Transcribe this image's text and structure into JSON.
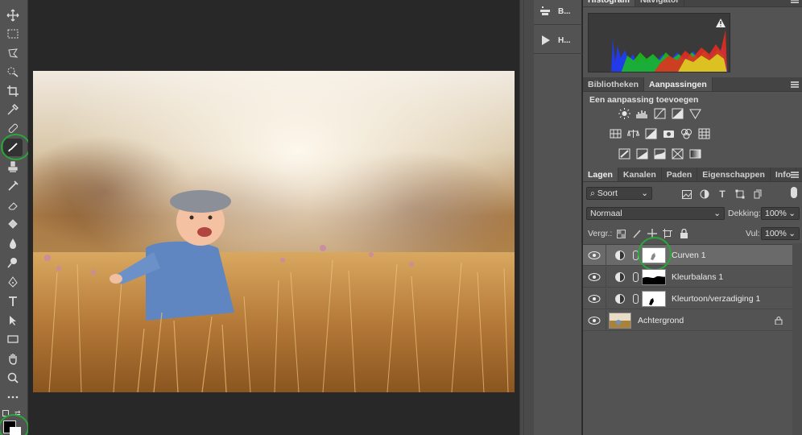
{
  "toolbar": {
    "tools": [
      "move-icon",
      "marquee-icon",
      "lasso-icon",
      "quick-select-icon",
      "crop-icon",
      "eyedropper-icon",
      "healing-icon",
      "brush-icon",
      "stamp-icon",
      "history-brush-icon",
      "eraser-icon",
      "paint-bucket-icon",
      "blur-icon",
      "dodge-icon",
      "pen-icon",
      "type-icon",
      "path-select-icon",
      "rectangle-icon",
      "hand-icon",
      "zoom-icon",
      "more-icon"
    ],
    "active_tool": "brush-icon",
    "highlight_color": "#2aa53a"
  },
  "mini_dock": {
    "items": [
      {
        "icon": "brushes-icon",
        "label": "B..."
      },
      {
        "icon": "play-icon",
        "label": "H..."
      }
    ]
  },
  "panels": {
    "top_tabs": [
      "Histogram",
      "Navigator"
    ],
    "adjust_tabs": [
      "Bibliotheken",
      "Aanpassingen"
    ],
    "adjust_title": "Een aanpassing toevoegen",
    "layer_tabs": [
      "Lagen",
      "Kanalen",
      "Paden",
      "Eigenschappen",
      "Info"
    ],
    "kind_filter": "Soort",
    "blend_mode": "Normaal",
    "opacity_label": "Dekking:",
    "opacity_value": "100%",
    "lock_label": "Vergr.:",
    "fill_label": "Vul:",
    "fill_value": "100%",
    "layers": [
      {
        "name": "Curven 1",
        "selected": true
      },
      {
        "name": "Kleurbalans 1",
        "selected": false
      },
      {
        "name": "Kleurtoon/verzadiging 1",
        "selected": false
      },
      {
        "name": "Achtergrond",
        "selected": false
      }
    ]
  }
}
